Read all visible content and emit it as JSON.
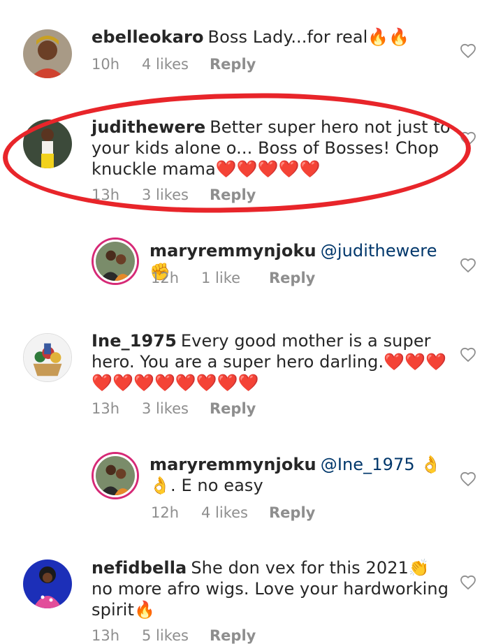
{
  "comments": [
    {
      "username": "ebelleokaro",
      "text": "Boss Lady...for real🔥🔥",
      "time": "10h",
      "likes": "4 likes",
      "reply_label": "Reply"
    },
    {
      "username": "judithewere",
      "text": "Better super hero not just to your kids alone o... Boss of Bosses! Chop knuckle mama❤️❤️❤️❤️❤️",
      "time": "13h",
      "likes": "3 likes",
      "reply_label": "Reply"
    },
    {
      "username": "maryremmynjoku",
      "mention": "@judithewere",
      "text": "✊",
      "time": "12h",
      "likes": "1 like",
      "reply_label": "Reply"
    },
    {
      "username": "Ine_1975",
      "text": "Every good mother is a super hero. You are a super hero darling.❤️❤️❤️❤️❤️❤️❤️❤️❤️❤️❤️",
      "time": "13h",
      "likes": "3 likes",
      "reply_label": "Reply"
    },
    {
      "username": "maryremmynjoku",
      "mention": "@Ine_1975",
      "text": "👌👌. E no easy",
      "time": "12h",
      "likes": "4 likes",
      "reply_label": "Reply"
    },
    {
      "username": "nefidbella",
      "text": "She don vex for this 2021👏 no more afro wigs. Love your hardworking spirit🔥",
      "time": "13h",
      "likes": "5 likes",
      "reply_label": "Reply"
    }
  ],
  "colors": {
    "highlight": "#e8252a",
    "mention": "#00376b",
    "meta": "#8e8e8e"
  },
  "icons": {
    "like": "heart-outline-icon"
  }
}
